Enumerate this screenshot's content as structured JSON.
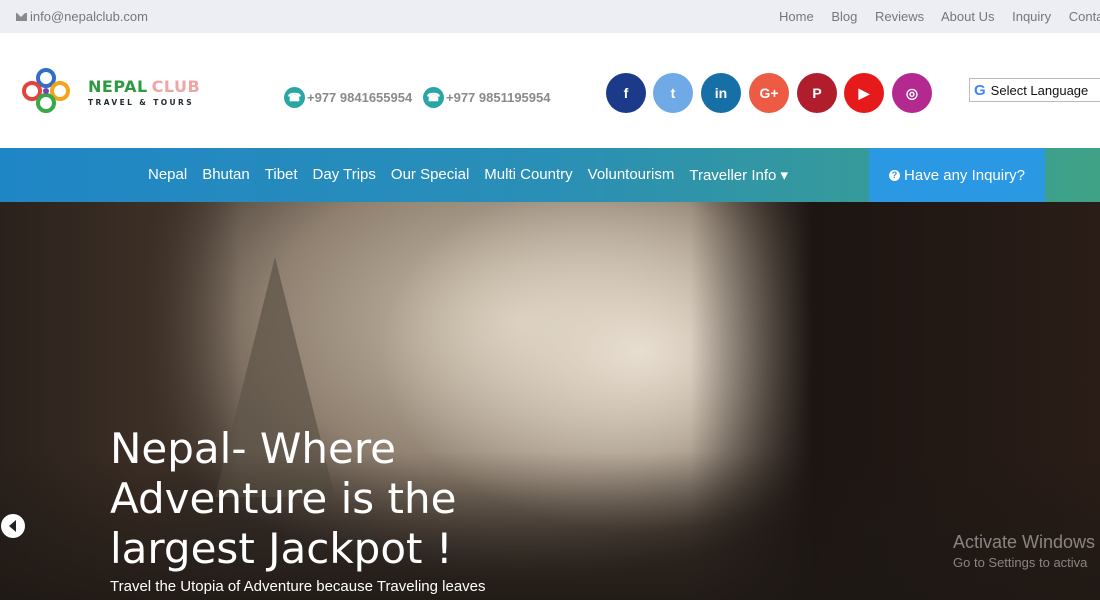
{
  "topbar": {
    "email": "info@nepalclub.com",
    "links": [
      "Home",
      "Blog",
      "Reviews",
      "About Us",
      "Inquiry",
      "Conta"
    ]
  },
  "header": {
    "logo": {
      "line1_a": "NEPAL",
      "line1_b": "CLUB",
      "line2": "TRAVEL & TOURS"
    },
    "phones": [
      "+977 9841655954",
      "+977 9851195954"
    ],
    "social": [
      {
        "name": "facebook",
        "glyph": "f",
        "color": "#1b3b8a"
      },
      {
        "name": "twitter",
        "glyph": "t",
        "color": "#6fa9e6"
      },
      {
        "name": "linkedin",
        "glyph": "in",
        "color": "#176fa8"
      },
      {
        "name": "google-plus",
        "glyph": "G+",
        "color": "#ee5b45"
      },
      {
        "name": "pinterest",
        "glyph": "P",
        "color": "#b01e2e"
      },
      {
        "name": "youtube",
        "glyph": "▶",
        "color": "#e61a1a"
      },
      {
        "name": "instagram",
        "glyph": "◎",
        "color": "#b4298f"
      }
    ],
    "translate": {
      "g": "G",
      "label": "Select Language"
    }
  },
  "nav": {
    "items": [
      "Nepal",
      "Bhutan",
      "Tibet",
      "Day Trips",
      "Our Special",
      "Multi Country",
      "Voluntourism",
      "Traveller Info ▾"
    ],
    "inquiry": "Have any Inquiry?"
  },
  "hero": {
    "headline": "Nepal- Where Adventure is the largest Jackpot !",
    "subtitle": "Travel the Utopia of Adventure because Traveling leaves"
  },
  "watermark": {
    "line1": "Activate Windows",
    "line2": "Go to Settings to activa"
  }
}
